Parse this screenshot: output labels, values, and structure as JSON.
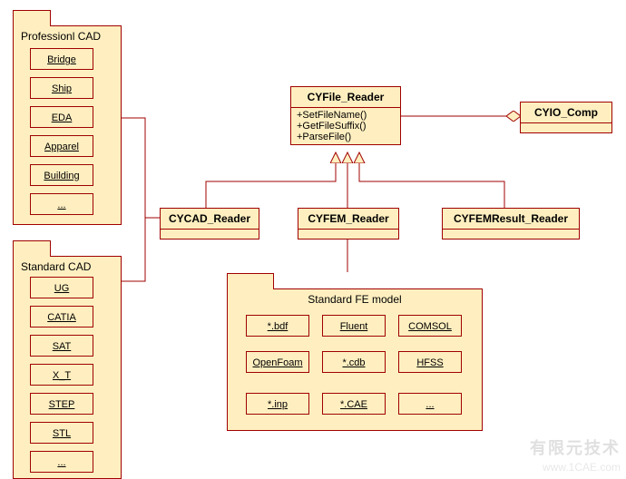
{
  "packages": {
    "prof_cad": {
      "title": "Professionl CAD",
      "items": [
        "Bridge",
        "Ship",
        "EDA",
        "Apparel",
        "Building",
        "..."
      ]
    },
    "std_cad": {
      "title": "Standard CAD",
      "items": [
        "UG",
        "CATIA",
        "SAT",
        "X_T",
        "STEP",
        "STL",
        "..."
      ]
    },
    "std_fe": {
      "title": "Standard FE model",
      "items": [
        "*.bdf",
        "Fluent",
        "COMSOL",
        "OpenFoam",
        "*.cdb",
        "HFSS",
        "*.inp",
        "*.CAE",
        "..."
      ]
    }
  },
  "classes": {
    "cyfile_reader": {
      "name": "CYFile_Reader",
      "ops": [
        "+SetFileName()",
        "+GetFileSuffix()",
        "+ParseFile()"
      ]
    },
    "cyio_comp": {
      "name": "CYIO_Comp"
    },
    "cycad_reader": {
      "name": "CYCAD_Reader"
    },
    "cyfem_reader": {
      "name": "CYFEM_Reader"
    },
    "cyfemresult_reader": {
      "name": "CYFEMResult_Reader"
    }
  },
  "watermark": {
    "line1": "有限元技术",
    "line2": "www.1CAE.com"
  }
}
